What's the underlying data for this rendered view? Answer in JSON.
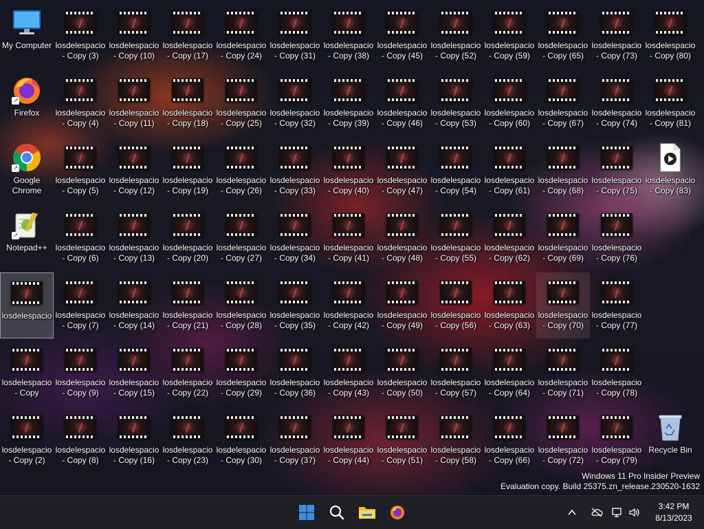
{
  "desktop": {
    "icons": [
      {
        "label": "My Computer",
        "type": "computer",
        "shortcut": false
      },
      {
        "label": "Firefox",
        "type": "firefox",
        "shortcut": true
      },
      {
        "label": "Google\nChrome",
        "type": "chrome",
        "shortcut": true
      },
      {
        "label": "Notepad++",
        "type": "notepad",
        "shortcut": true
      },
      {
        "label": "losdelespacio",
        "type": "video",
        "selected": true
      },
      {
        "label": "losdelespacio\n- Copy",
        "type": "video"
      },
      {
        "label": "losdelespacio\n- Copy (2)",
        "type": "video"
      },
      {
        "label": "losdelespacio\n- Copy (3)",
        "type": "video"
      },
      {
        "label": "losdelespacio\n- Copy (4)",
        "type": "video"
      },
      {
        "label": "losdelespacio\n- Copy (5)",
        "type": "video"
      },
      {
        "label": "losdelespacio\n- Copy (6)",
        "type": "video"
      },
      {
        "label": "losdelespacio\n- Copy (7)",
        "type": "video"
      },
      {
        "label": "losdelespacio\n- Copy (9)",
        "type": "video"
      },
      {
        "label": "losdelespacio\n- Copy (8)",
        "type": "video"
      },
      {
        "label": "losdelespacio\n- Copy (10)",
        "type": "video"
      },
      {
        "label": "losdelespacio\n- Copy (11)",
        "type": "video"
      },
      {
        "label": "losdelespacio\n- Copy (12)",
        "type": "video"
      },
      {
        "label": "losdelespacio\n- Copy (13)",
        "type": "video"
      },
      {
        "label": "losdelespacio\n- Copy (14)",
        "type": "video"
      },
      {
        "label": "losdelespacio\n- Copy (15)",
        "type": "video"
      },
      {
        "label": "losdelespacio\n- Copy (16)",
        "type": "video"
      },
      {
        "label": "losdelespacio\n- Copy (17)",
        "type": "video"
      },
      {
        "label": "losdelespacio\n- Copy (18)",
        "type": "video"
      },
      {
        "label": "losdelespacio\n- Copy (19)",
        "type": "video"
      },
      {
        "label": "losdelespacio\n- Copy (20)",
        "type": "video"
      },
      {
        "label": "losdelespacio\n- Copy (21)",
        "type": "video"
      },
      {
        "label": "losdelespacio\n- Copy (22)",
        "type": "video"
      },
      {
        "label": "losdelespacio\n- Copy (23)",
        "type": "video"
      },
      {
        "label": "losdelespacio\n- Copy (24)",
        "type": "video"
      },
      {
        "label": "losdelespacio\n- Copy (25)",
        "type": "video"
      },
      {
        "label": "losdelespacio\n- Copy (26)",
        "type": "video"
      },
      {
        "label": "losdelespacio\n- Copy (27)",
        "type": "video"
      },
      {
        "label": "losdelespacio\n- Copy (28)",
        "type": "video"
      },
      {
        "label": "losdelespacio\n- Copy (29)",
        "type": "video"
      },
      {
        "label": "losdelespacio\n- Copy (30)",
        "type": "video"
      },
      {
        "label": "losdelespacio\n- Copy (31)",
        "type": "video"
      },
      {
        "label": "losdelespacio\n- Copy (32)",
        "type": "video"
      },
      {
        "label": "losdelespacio\n- Copy (33)",
        "type": "video"
      },
      {
        "label": "losdelespacio\n- Copy (34)",
        "type": "video"
      },
      {
        "label": "losdelespacio\n- Copy (35)",
        "type": "video"
      },
      {
        "label": "losdelespacio\n- Copy (36)",
        "type": "video"
      },
      {
        "label": "losdelespacio\n- Copy (37)",
        "type": "video"
      },
      {
        "label": "losdelespacio\n- Copy (38)",
        "type": "video"
      },
      {
        "label": "losdelespacio\n- Copy (39)",
        "type": "video"
      },
      {
        "label": "losdelespacio\n- Copy (40)",
        "type": "video"
      },
      {
        "label": "losdelespacio\n- Copy (41)",
        "type": "video"
      },
      {
        "label": "losdelespacio\n- Copy (42)",
        "type": "video"
      },
      {
        "label": "losdelespacio\n- Copy (43)",
        "type": "video"
      },
      {
        "label": "losdelespacio\n- Copy (44)",
        "type": "video"
      },
      {
        "label": "losdelespacio\n- Copy (45)",
        "type": "video"
      },
      {
        "label": "losdelespacio\n- Copy (46)",
        "type": "video"
      },
      {
        "label": "losdelespacio\n- Copy (47)",
        "type": "video"
      },
      {
        "label": "losdelespacio\n- Copy (48)",
        "type": "video"
      },
      {
        "label": "losdelespacio\n- Copy (49)",
        "type": "video"
      },
      {
        "label": "losdelespacio\n- Copy (50)",
        "type": "video"
      },
      {
        "label": "losdelespacio\n- Copy (51)",
        "type": "video"
      },
      {
        "label": "losdelespacio\n- Copy (52)",
        "type": "video"
      },
      {
        "label": "losdelespacio\n- Copy (53)",
        "type": "video"
      },
      {
        "label": "losdelespacio\n- Copy (54)",
        "type": "video"
      },
      {
        "label": "losdelespacio\n- Copy (55)",
        "type": "video"
      },
      {
        "label": "losdelespacio\n- Copy (56)",
        "type": "video"
      },
      {
        "label": "losdelespacio\n- Copy (57)",
        "type": "video"
      },
      {
        "label": "losdelespacio\n- Copy (58)",
        "type": "video"
      },
      {
        "label": "losdelespacio\n- Copy (59)",
        "type": "video"
      },
      {
        "label": "losdelespacio\n- Copy (60)",
        "type": "video"
      },
      {
        "label": "losdelespacio\n- Copy (61)",
        "type": "video"
      },
      {
        "label": "losdelespacio\n- Copy (62)",
        "type": "video"
      },
      {
        "label": "losdelespacio\n- Copy (63)",
        "type": "video"
      },
      {
        "label": "losdelespacio\n- Copy (64)",
        "type": "video"
      },
      {
        "label": "losdelespacio\n- Copy (66)",
        "type": "video"
      },
      {
        "label": "losdelespacio\n- Copy (65)",
        "type": "video"
      },
      {
        "label": "losdelespacio\n- Copy (67)",
        "type": "video"
      },
      {
        "label": "losdelespacio\n- Copy (68)",
        "type": "video"
      },
      {
        "label": "losdelespacio\n- Copy (69)",
        "type": "video"
      },
      {
        "label": "losdelespacio\n- Copy (70)",
        "type": "video",
        "hover": true
      },
      {
        "label": "losdelespacio\n- Copy (71)",
        "type": "video"
      },
      {
        "label": "losdelespacio\n- Copy (72)",
        "type": "video"
      },
      {
        "label": "losdelespacio\n- Copy (73)",
        "type": "video"
      },
      {
        "label": "losdelespacio\n- Copy (74)",
        "type": "video"
      },
      {
        "label": "losdelespacio\n- Copy (75)",
        "type": "video"
      },
      {
        "label": "losdelespacio\n- Copy (76)",
        "type": "video"
      },
      {
        "label": "losdelespacio\n- Copy (77)",
        "type": "video"
      },
      {
        "label": "losdelespacio\n- Copy (78)",
        "type": "video"
      },
      {
        "label": "losdelespacio\n- Copy (79)",
        "type": "video"
      },
      {
        "label": "losdelespacio\n- Copy (80)",
        "type": "video"
      },
      {
        "label": "losdelespacio\n- Copy (81)",
        "type": "video"
      },
      {
        "label": "losdelespacio\n- Copy (83)",
        "type": "media-file"
      },
      {
        "label": "Recycle Bin",
        "type": "recycle-bin",
        "pin_bottom": true
      }
    ]
  },
  "watermark": {
    "line1": "Windows 11 Pro Insider Preview",
    "line2": "Evaluation copy. Build 25375.zn_release.230520-1632"
  },
  "taskbar": {
    "apps": [
      "start-icon",
      "search-icon",
      "file-explorer-icon",
      "firefox-icon"
    ],
    "tray": [
      "chevron-up-icon",
      "network-off-icon",
      "display-icon",
      "speaker-icon"
    ],
    "time": "3:42 PM",
    "date": "8/13/2023"
  },
  "colors": {
    "taskbar_bg": "#1f2026",
    "start_blue": "#3a8ee6",
    "folder_yellow": "#f4c02a"
  }
}
